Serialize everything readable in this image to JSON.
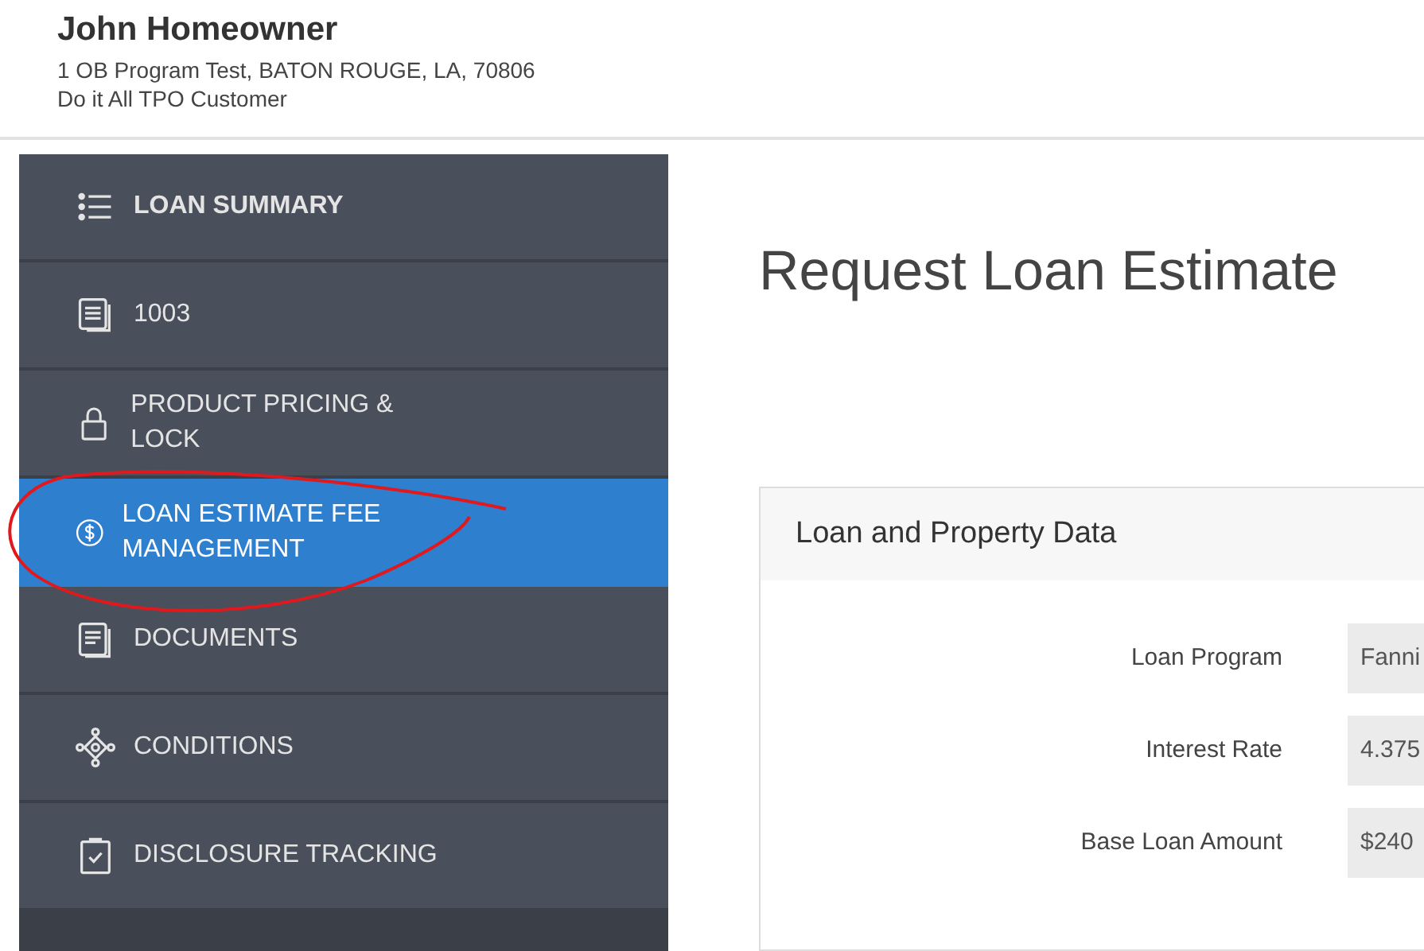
{
  "header": {
    "name": "John Homeowner",
    "address": "1 OB Program Test, BATON ROUGE, LA, 70806",
    "customer": "Do it All TPO Customer"
  },
  "sidebar": {
    "items": [
      {
        "label": "LOAN SUMMARY",
        "kind": "list",
        "bold": true,
        "selected": false
      },
      {
        "label": "1003",
        "kind": "form",
        "bold": false,
        "selected": false
      },
      {
        "label": "PRODUCT PRICING & LOCK",
        "kind": "lock",
        "bold": false,
        "selected": false
      },
      {
        "label": "LOAN ESTIMATE FEE MANAGEMENT",
        "kind": "dollar",
        "bold": false,
        "selected": true
      },
      {
        "label": "DOCUMENTS",
        "kind": "document",
        "bold": false,
        "selected": false
      },
      {
        "label": "CONDITIONS",
        "kind": "network",
        "bold": false,
        "selected": false
      },
      {
        "label": "DISCLOSURE TRACKING",
        "kind": "clipboard",
        "bold": false,
        "selected": false
      }
    ]
  },
  "page_title": "Request Loan Estimate",
  "card": {
    "title": "Loan and Property Data",
    "fields": [
      {
        "label": "Loan Program",
        "value": "Fanni"
      },
      {
        "label": "Interest Rate",
        "value": "4.375"
      },
      {
        "label": "Base Loan Amount",
        "value": "$240"
      }
    ]
  }
}
